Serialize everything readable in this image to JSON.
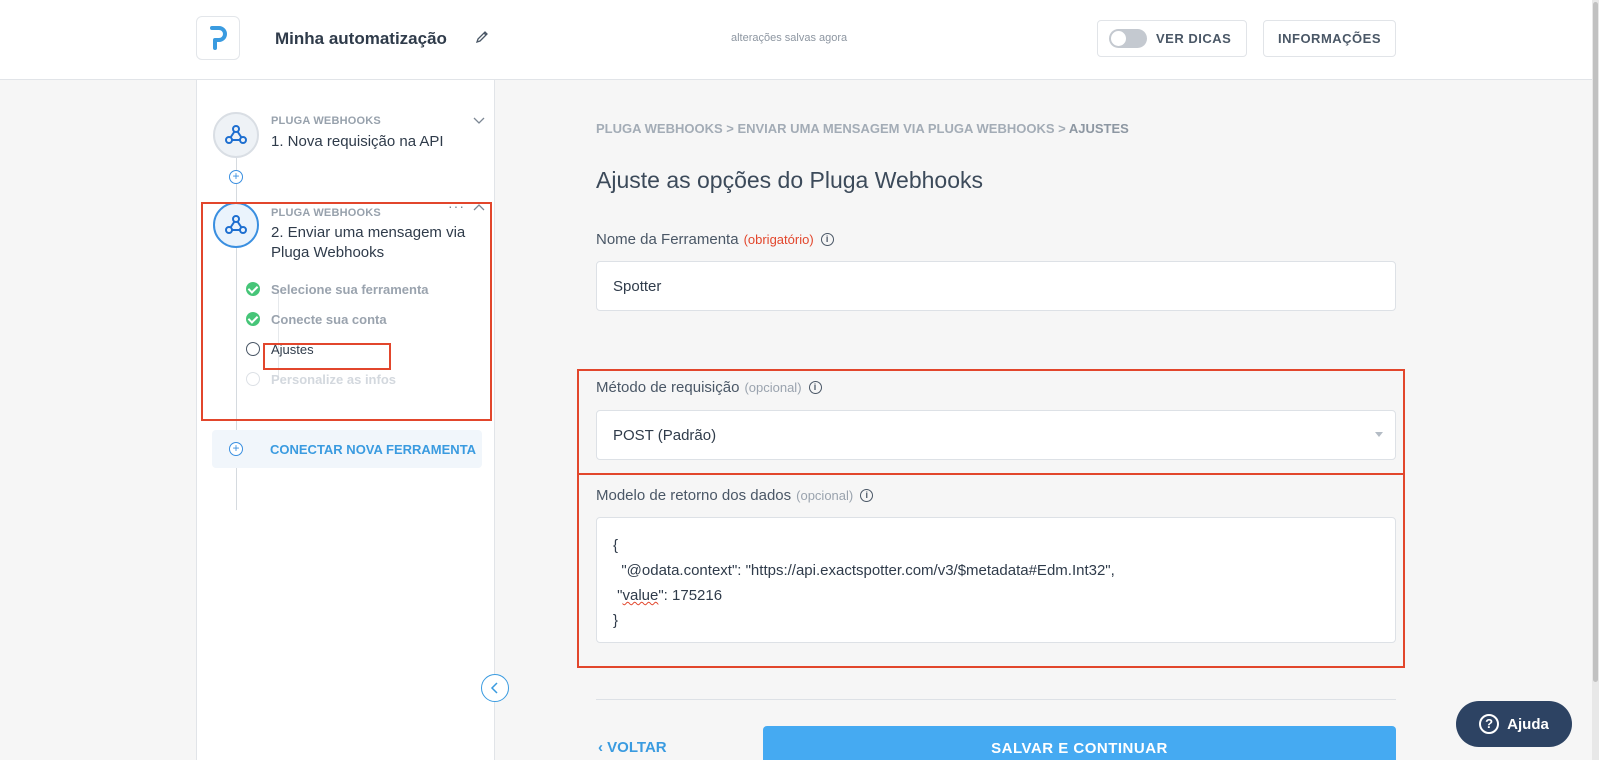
{
  "header": {
    "title": "Minha automatização",
    "saved_status": "alterações salvas agora",
    "tips_label": "VER DICAS",
    "info_label": "INFORMAÇÕES"
  },
  "sidebar": {
    "step1": {
      "app": "PLUGA WEBHOOKS",
      "title": "1. Nova requisição na API"
    },
    "step2": {
      "app": "PLUGA WEBHOOKS",
      "title_line1": "2. Enviar uma mensagem via",
      "title_line2": "Pluga Webhooks",
      "substeps": [
        {
          "label": "Selecione sua ferramenta",
          "state": "done"
        },
        {
          "label": "Conecte sua conta",
          "state": "done"
        },
        {
          "label": "Ajustes",
          "state": "current"
        },
        {
          "label": "Personalize as infos",
          "state": "pending"
        }
      ]
    },
    "connect_label": "CONECTAR NOVA FERRAMENTA",
    "menu_dots": "···"
  },
  "main": {
    "breadcrumb": {
      "path": "PLUGA WEBHOOKS > ENVIAR UMA MENSAGEM VIA PLUGA WEBHOOKS > ",
      "current": "AJUSTES"
    },
    "title": "Ajuste as opções do Pluga Webhooks",
    "tool_name": {
      "label": "Nome da Ferramenta",
      "required": "(obrigatório)",
      "value": "Spotter"
    },
    "method": {
      "label": "Método de requisição",
      "optional": "(opcional)",
      "value": "POST (Padrão)"
    },
    "model": {
      "label": "Modelo de retorno dos dados",
      "optional": "(opcional)",
      "line1": "{",
      "line2": "  \"@odata.context\": \"https://api.exactspotter.com/v3/$metadata#Edm.Int32\",",
      "line3_pre": " \"",
      "line3_word": "value",
      "line3_post": "\": 175216",
      "line4": "}"
    },
    "back_label": "VOLTAR",
    "save_label": "SALVAR E CONTINUAR"
  },
  "help_label": "Ajuda",
  "colors": {
    "accent": "#45aaf2",
    "highlight": "#e2462c",
    "success": "#46c578",
    "help_bg": "#2d4363"
  }
}
